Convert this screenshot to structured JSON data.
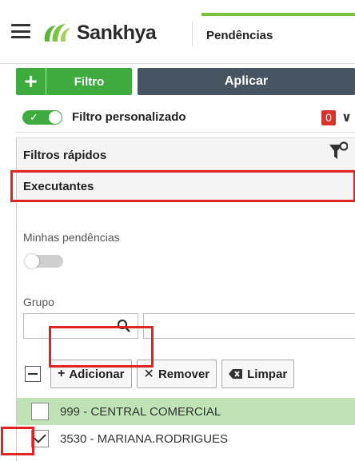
{
  "header": {
    "app_name": "Sankhya",
    "tab_title": "Pendências",
    "accent": "#7dc242"
  },
  "filter_bar": {
    "add_icon": "plus-icon",
    "filter_label": "Filtro",
    "apply_label": "Aplicar",
    "filter_color": "#3fab3f",
    "apply_color": "#465561"
  },
  "custom_filter": {
    "enabled": true,
    "label": "Filtro personalizado",
    "count": "0",
    "badge_color": "#d9342b"
  },
  "quick_filters": {
    "title": "Filtros rápidos",
    "icon": "funnel-settings-icon"
  },
  "executantes": {
    "title": "Executantes",
    "my_pending_label": "Minhas pendências",
    "my_pending_enabled": false,
    "group_label": "Grupo",
    "group_code_value": "",
    "group_desc_value": "",
    "toolbar": {
      "add_label": "Adicionar",
      "remove_label": "Remover",
      "clear_label": "Limpar"
    },
    "rows": [
      {
        "label": "999 - CENTRAL COMERCIAL",
        "checked": false,
        "highlighted": true
      },
      {
        "label": "3530 - MARIANA.RODRIGUES",
        "checked": true,
        "highlighted": false
      }
    ]
  },
  "annotation_color": "#e02424"
}
